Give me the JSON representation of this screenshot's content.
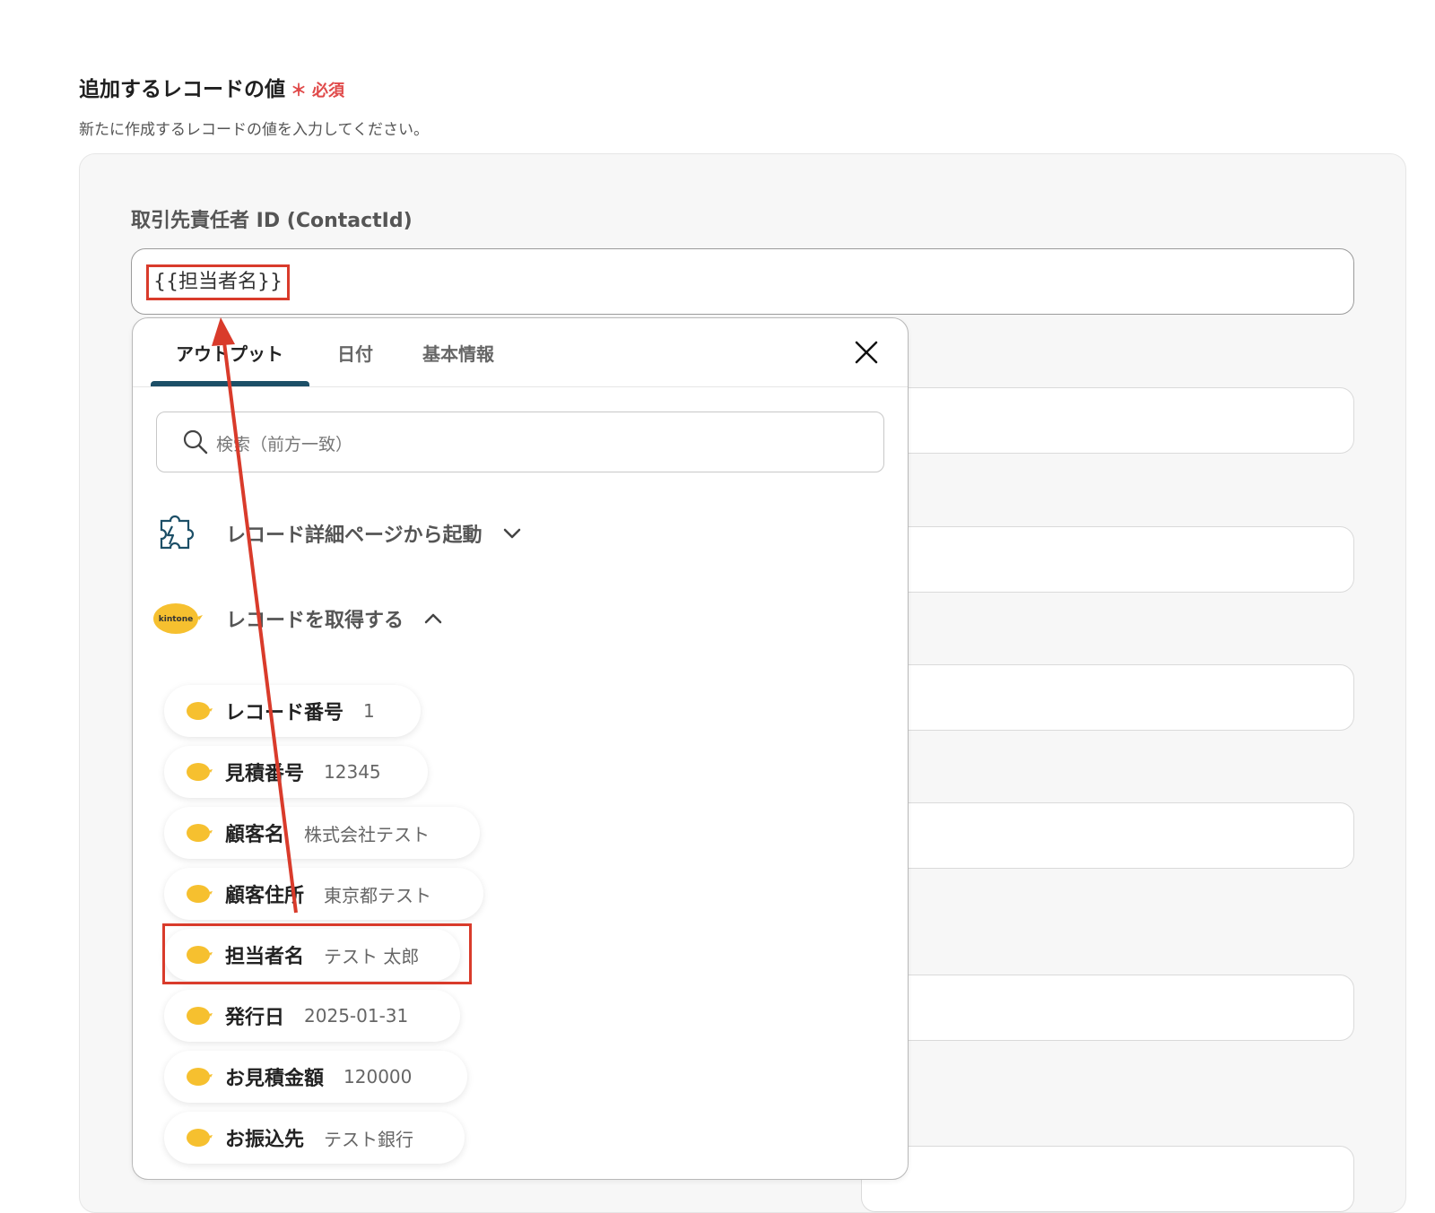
{
  "section": {
    "title": "追加するレコードの値",
    "required_mark": "＊",
    "required_label": "必須",
    "description": "新たに作成するレコードの値を入力してください。"
  },
  "field": {
    "label": "取引先責任者 ID (ContactId)",
    "value": "{{担当者名}}"
  },
  "dropdown": {
    "tabs": [
      "アウトプット",
      "日付",
      "基本情報"
    ],
    "active_tab": "アウトプット",
    "search_placeholder": "検索（前方一致）",
    "groups": [
      {
        "label": "レコード詳細ページから起動",
        "icon": "puzzle-lightning-icon",
        "expanded": false
      },
      {
        "label": "レコードを取得する",
        "icon": "kintone-logo-icon",
        "logo_text": "kintone",
        "expanded": true
      }
    ],
    "items": [
      {
        "name": "レコード番号",
        "value": "1"
      },
      {
        "name": "見積番号",
        "value": "12345"
      },
      {
        "name": "顧客名",
        "value": "株式会社テスト"
      },
      {
        "name": "顧客住所",
        "value": "東京都テスト"
      },
      {
        "name": "担当者名",
        "value": "テスト 太郎",
        "highlighted": true
      },
      {
        "name": "発行日",
        "value": "2025-01-31"
      },
      {
        "name": "お見積金額",
        "value": "120000"
      },
      {
        "name": "お振込先",
        "value": "テスト銀行"
      }
    ]
  },
  "colors": {
    "accent": "#1c4f67",
    "annotation": "#d93b2b",
    "required": "#e04a4a",
    "kintone": "#f6c02f"
  }
}
